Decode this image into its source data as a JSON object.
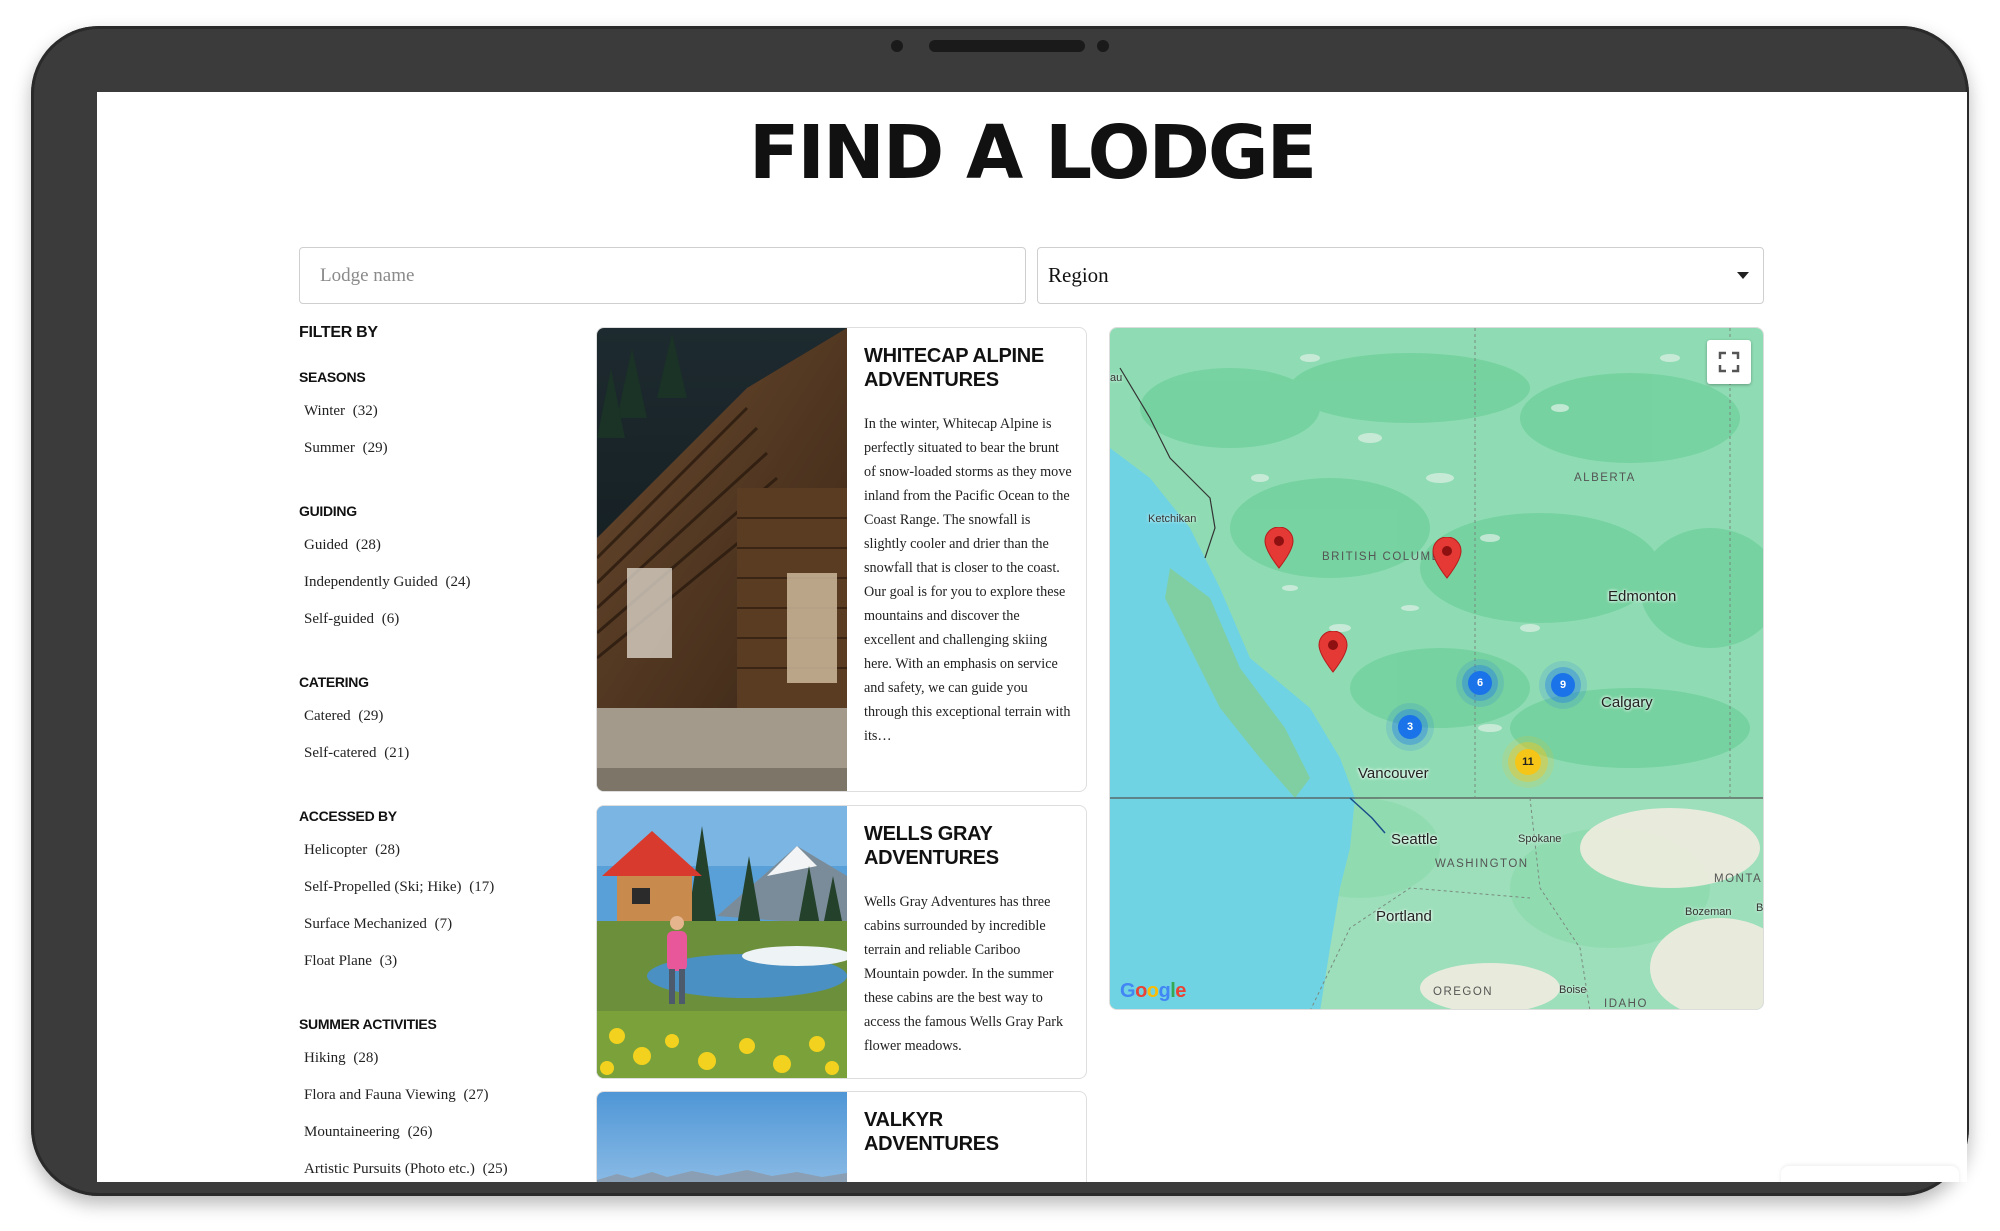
{
  "page": {
    "title": "FIND A LODGE"
  },
  "search": {
    "placeholder": "Lodge name",
    "value": ""
  },
  "region_select": {
    "selected": "Region"
  },
  "filters": {
    "title": "FILTER BY",
    "groups": [
      {
        "title": "SEASONS",
        "options": [
          {
            "label": "Winter",
            "count": "(32)"
          },
          {
            "label": "Summer",
            "count": "(29)"
          }
        ]
      },
      {
        "title": "GUIDING",
        "options": [
          {
            "label": "Guided",
            "count": "(28)"
          },
          {
            "label": "Independently Guided",
            "count": "(24)"
          },
          {
            "label": "Self-guided",
            "count": "(6)"
          }
        ]
      },
      {
        "title": "CATERING",
        "options": [
          {
            "label": "Catered",
            "count": "(29)"
          },
          {
            "label": "Self-catered",
            "count": "(21)"
          }
        ]
      },
      {
        "title": "ACCESSED BY",
        "options": [
          {
            "label": "Helicopter",
            "count": "(28)"
          },
          {
            "label": "Self-Propelled (Ski; Hike)",
            "count": "(17)"
          },
          {
            "label": "Surface Mechanized",
            "count": "(7)"
          },
          {
            "label": "Float Plane",
            "count": "(3)"
          }
        ]
      },
      {
        "title": "SUMMER ACTIVITIES",
        "options": [
          {
            "label": "Hiking",
            "count": "(28)"
          },
          {
            "label": "Flora and Fauna Viewing",
            "count": "(27)"
          },
          {
            "label": "Mountaineering",
            "count": "(26)"
          },
          {
            "label": "Artistic Pursuits (Photo etc.)",
            "count": "(25)"
          }
        ]
      }
    ]
  },
  "lodges": [
    {
      "name": "WHITECAP ALPINE ADVENTURES",
      "description": "In the winter, Whitecap Alpine is perfectly situated to bear the brunt of snow-loaded storms as they move inland from the Pacific Ocean to the Coast Range. The snowfall is slightly cooler and drier than the snowfall that is closer to the coast. Our goal is for you to explore these mountains and discover the excellent and challenging skiing here. With an emphasis on service and safety, we can guide you through this exceptional terrain with its…"
    },
    {
      "name": "WELLS GRAY ADVENTURES",
      "description": "Wells Gray Adventures has three cabins surrounded by incredible terrain and reliable Cariboo Mountain powder. In the summer these cabins are the best way to access the famous Wells Gray Park flower meadows."
    },
    {
      "name": "VALKYR ADVENTURES",
      "description": ""
    }
  ],
  "map": {
    "labels": {
      "alberta": "ALBERTA",
      "british_columbia": "BRITISH COLUMBIA",
      "washington": "WASHINGTON",
      "oregon": "OREGON",
      "idaho": "IDAHO",
      "montana": "MONTA",
      "ketchikan": "Ketchikan",
      "edmonton": "Edmonton",
      "calgary": "Calgary",
      "vancouver": "Vancouver",
      "seattle": "Seattle",
      "spokane": "Spokane",
      "portland": "Portland",
      "bozeman": "Bozeman",
      "boise": "Boise",
      "au": "au",
      "b": "B"
    },
    "clusters": [
      {
        "count": "6",
        "color": "blue"
      },
      {
        "count": "9",
        "color": "blue"
      },
      {
        "count": "3",
        "color": "blue"
      },
      {
        "count": "11",
        "color": "yellow"
      }
    ],
    "pins": 3,
    "attribution": "Google",
    "colors": {
      "land": "#8fdcb4",
      "water": "#6fd3e3",
      "forest": "#62c990",
      "us_land": "#a8e2c0"
    }
  }
}
